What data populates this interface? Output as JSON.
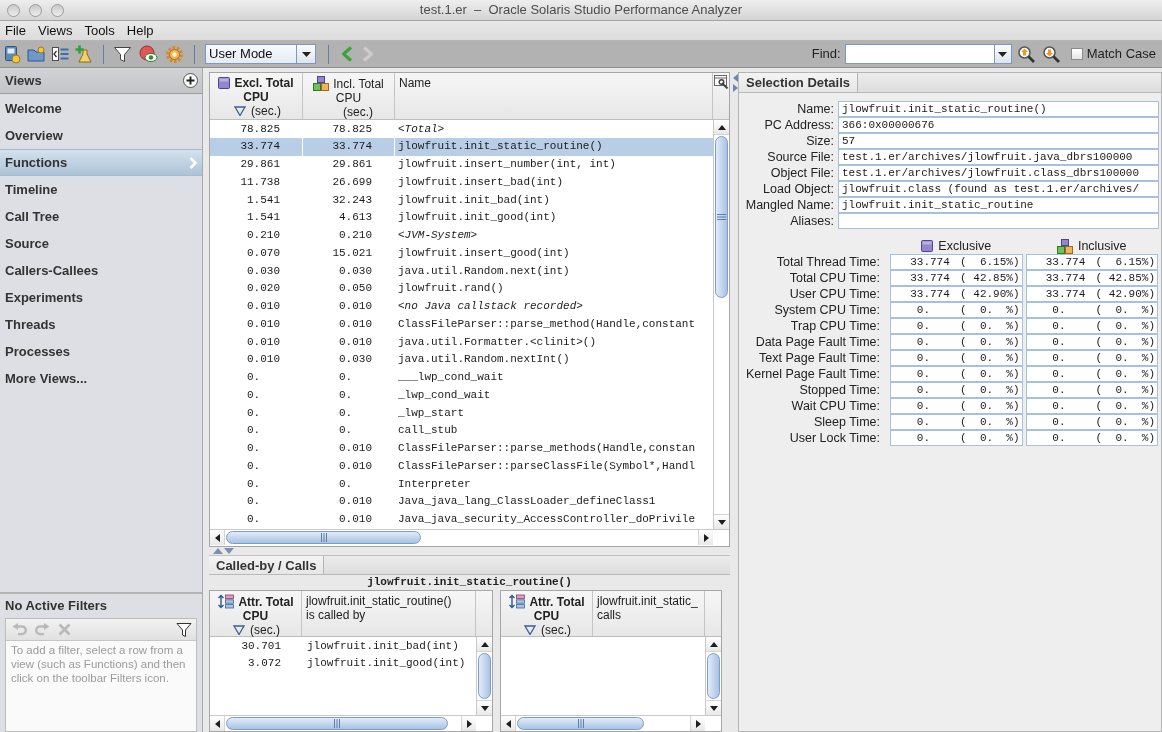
{
  "window": {
    "title": "test.1.er  –  Oracle Solaris Studio Performance Analyzer"
  },
  "menu": [
    "File",
    "Views",
    "Tools",
    "Help"
  ],
  "toolbar": {
    "view_mode": "User Mode",
    "navigation": [
      {
        "kind": "back",
        "disabled": false
      },
      {
        "kind": "forward",
        "disabled": true
      }
    ],
    "find": {
      "label": "Find:",
      "match_case": {
        "label": "Match Case",
        "checked": false
      }
    }
  },
  "sidebar": {
    "title": "Views",
    "items": [
      {
        "label": "Welcome",
        "selected": false
      },
      {
        "label": "Overview",
        "selected": false
      },
      {
        "label": "Functions",
        "selected": true
      },
      {
        "label": "Timeline",
        "selected": false
      },
      {
        "label": "Call Tree",
        "selected": false
      },
      {
        "label": "Source",
        "selected": false
      },
      {
        "label": "Callers-Callees",
        "selected": false
      },
      {
        "label": "Experiments",
        "selected": false
      },
      {
        "label": "Threads",
        "selected": false
      },
      {
        "label": "Processes",
        "selected": false
      },
      {
        "label": "More Views...",
        "selected": false
      }
    ],
    "filters": {
      "title": "No Active Filters",
      "actions": [
        {
          "kind": "undo",
          "disabled": true
        },
        {
          "kind": "redo",
          "disabled": true
        },
        {
          "kind": "clear",
          "disabled": true
        }
      ],
      "hint": "To add a filter, select a row from a view (such as Functions) and then click on the toolbar Filters icon."
    }
  },
  "functions_table": {
    "columns": [
      {
        "kind": "exclusive",
        "lines": [
          "Excl. Total",
          "CPU"
        ],
        "unit": "(sec.)",
        "sorted": true
      },
      {
        "kind": "inclusive",
        "lines": [
          "Incl. Total",
          "CPU"
        ],
        "unit": "(sec.)",
        "sorted": false
      },
      {
        "kind": "name",
        "lines": [
          "Name"
        ],
        "sorted": false
      }
    ],
    "rows": [
      {
        "exclusive_cpu": "78.825",
        "inclusive_cpu": "78.825",
        "name": "<Total>",
        "kind": "pseudo",
        "selected": false
      },
      {
        "exclusive_cpu": "33.774",
        "inclusive_cpu": "33.774",
        "name": "jlowfruit.init_static_routine()",
        "kind": "function",
        "selected": true
      },
      {
        "exclusive_cpu": "29.861",
        "inclusive_cpu": "29.861",
        "name": "jlowfruit.insert_number(int, int)",
        "kind": "function",
        "selected": false
      },
      {
        "exclusive_cpu": "11.738",
        "inclusive_cpu": "26.699",
        "name": "jlowfruit.insert_bad(int)",
        "kind": "function",
        "selected": false
      },
      {
        "exclusive_cpu": "1.541",
        "inclusive_cpu": "32.243",
        "name": "jlowfruit.init_bad(int)",
        "kind": "function",
        "selected": false
      },
      {
        "exclusive_cpu": "1.541",
        "inclusive_cpu": "4.613",
        "name": "jlowfruit.init_good(int)",
        "kind": "function",
        "selected": false
      },
      {
        "exclusive_cpu": "0.210",
        "inclusive_cpu": "0.210",
        "name": "<JVM-System>",
        "kind": "pseudo",
        "selected": false
      },
      {
        "exclusive_cpu": "0.070",
        "inclusive_cpu": "15.021",
        "name": "jlowfruit.insert_good(int)",
        "kind": "function",
        "selected": false
      },
      {
        "exclusive_cpu": "0.030",
        "inclusive_cpu": "0.030",
        "name": "java.util.Random.next(int)",
        "kind": "function",
        "selected": false
      },
      {
        "exclusive_cpu": "0.020",
        "inclusive_cpu": "0.050",
        "name": "jlowfruit.rand()",
        "kind": "function",
        "selected": false
      },
      {
        "exclusive_cpu": "0.010",
        "inclusive_cpu": "0.010",
        "name": "<no Java callstack recorded>",
        "kind": "pseudo",
        "selected": false
      },
      {
        "exclusive_cpu": "0.010",
        "inclusive_cpu": "0.010",
        "name": "ClassFileParser::parse_method(Handle,constant",
        "kind": "function",
        "selected": false
      },
      {
        "exclusive_cpu": "0.010",
        "inclusive_cpu": "0.010",
        "name": "java.util.Formatter.<clinit>()",
        "kind": "function",
        "selected": false
      },
      {
        "exclusive_cpu": "0.010",
        "inclusive_cpu": "0.030",
        "name": "java.util.Random.nextInt()",
        "kind": "function",
        "selected": false
      },
      {
        "exclusive_cpu": "0.",
        "inclusive_cpu": "0.",
        "name": "___lwp_cond_wait",
        "kind": "function",
        "selected": false
      },
      {
        "exclusive_cpu": "0.",
        "inclusive_cpu": "0.",
        "name": "_lwp_cond_wait",
        "kind": "function",
        "selected": false
      },
      {
        "exclusive_cpu": "0.",
        "inclusive_cpu": "0.",
        "name": "_lwp_start",
        "kind": "function",
        "selected": false
      },
      {
        "exclusive_cpu": "0.",
        "inclusive_cpu": "0.",
        "name": "call_stub",
        "kind": "function",
        "selected": false
      },
      {
        "exclusive_cpu": "0.",
        "inclusive_cpu": "0.010",
        "name": "ClassFileParser::parse_methods(Handle,constan",
        "kind": "function",
        "selected": false
      },
      {
        "exclusive_cpu": "0.",
        "inclusive_cpu": "0.010",
        "name": "ClassFileParser::parseClassFile(Symbol*,Handl",
        "kind": "function",
        "selected": false
      },
      {
        "exclusive_cpu": "0.",
        "inclusive_cpu": "0.",
        "name": "Interpreter",
        "kind": "function",
        "selected": false
      },
      {
        "exclusive_cpu": "0.",
        "inclusive_cpu": "0.010",
        "name": "Java_java_lang_ClassLoader_defineClass1",
        "kind": "function",
        "selected": false
      },
      {
        "exclusive_cpu": "0.",
        "inclusive_cpu": "0.010",
        "name": "Java_java_security_AccessController_doPrivile",
        "kind": "function",
        "selected": false
      }
    ]
  },
  "called_by_calls": {
    "tabs": [
      {
        "label": "Called-by / Calls",
        "selected": true
      }
    ],
    "title": "jlowfruit.init_static_routine()",
    "callers": {
      "columns": [
        {
          "kind": "attributed",
          "lines": [
            "Attr. Total",
            "CPU"
          ],
          "unit": "(sec.)",
          "sorted": true
        },
        {
          "kind": "name",
          "lines": [
            "jlowfruit.init_static_routine()",
            "is called by"
          ],
          "sorted": false
        }
      ],
      "rows": [
        {
          "attributed_cpu": "30.701",
          "name": "jlowfruit.init_bad(int)"
        },
        {
          "attributed_cpu": "3.072",
          "name": "jlowfruit.init_good(int)"
        }
      ]
    },
    "callees": {
      "columns": [
        {
          "kind": "attributed",
          "lines": [
            "Attr. Total",
            "CPU"
          ],
          "unit": "(sec.)",
          "sorted": true
        },
        {
          "kind": "name",
          "lines": [
            "jlowfruit.init_static_",
            "calls"
          ],
          "sorted": false
        }
      ]
    }
  },
  "selection_details": {
    "tabs": [
      {
        "label": "Selection Details",
        "selected": true
      }
    ],
    "fields": [
      {
        "label": "Name:",
        "value": "jlowfruit.init_static_routine()"
      },
      {
        "label": "PC Address:",
        "value": "366:0x00000676"
      },
      {
        "label": "Size:",
        "value": "57"
      },
      {
        "label": "Source File:",
        "value": "test.1.er/archives/jlowfruit.java_dbrs100000"
      },
      {
        "label": "Object File:",
        "value": "test.1.er/archives/jlowfruit.class_dbrs100000"
      },
      {
        "label": "Load Object:",
        "value": "jlowfruit.class (found as test.1.er/archives/"
      },
      {
        "label": "Mangled Name:",
        "value": "jlowfruit.init_static_routine"
      },
      {
        "label": "Aliases:"
      }
    ],
    "metric_columns": [
      {
        "kind": "exclusive",
        "label": "Exclusive"
      },
      {
        "kind": "inclusive",
        "label": "Inclusive"
      }
    ],
    "metrics": [
      {
        "label": "Total Thread Time:",
        "exclusive": {
          "value": "33.774",
          "share": "(  6.15%)"
        },
        "inclusive": {
          "value": "33.774",
          "share": "(  6.15%)"
        }
      },
      {
        "label": "Total CPU Time:",
        "exclusive": {
          "value": "33.774",
          "share": "( 42.85%)"
        },
        "inclusive": {
          "value": "33.774",
          "share": "( 42.85%)"
        }
      },
      {
        "label": "User CPU Time:",
        "exclusive": {
          "value": "33.774",
          "share": "( 42.90%)"
        },
        "inclusive": {
          "value": "33.774",
          "share": "( 42.90%)"
        }
      },
      {
        "label": "System CPU Time:",
        "exclusive": {
          "value": "0.",
          "share": "(  0.  %)"
        },
        "inclusive": {
          "value": "0.",
          "share": "(  0.  %)"
        }
      },
      {
        "label": "Trap CPU Time:",
        "exclusive": {
          "value": "0.",
          "share": "(  0.  %)"
        },
        "inclusive": {
          "value": "0.",
          "share": "(  0.  %)"
        }
      },
      {
        "label": "Data Page Fault Time:",
        "exclusive": {
          "value": "0.",
          "share": "(  0.  %)"
        },
        "inclusive": {
          "value": "0.",
          "share": "(  0.  %)"
        }
      },
      {
        "label": "Text Page Fault Time:",
        "exclusive": {
          "value": "0.",
          "share": "(  0.  %)"
        },
        "inclusive": {
          "value": "0.",
          "share": "(  0.  %)"
        }
      },
      {
        "label": "Kernel Page Fault Time:",
        "exclusive": {
          "value": "0.",
          "share": "(  0.  %)"
        },
        "inclusive": {
          "value": "0.",
          "share": "(  0.  %)"
        }
      },
      {
        "label": "Stopped Time:",
        "exclusive": {
          "value": "0.",
          "share": "(  0.  %)"
        },
        "inclusive": {
          "value": "0.",
          "share": "(  0.  %)"
        }
      },
      {
        "label": "Wait CPU Time:",
        "exclusive": {
          "value": "0.",
          "share": "(  0.  %)"
        },
        "inclusive": {
          "value": "0.",
          "share": "(  0.  %)"
        }
      },
      {
        "label": "Sleep Time:",
        "exclusive": {
          "value": "0.",
          "share": "(  0.  %)"
        },
        "inclusive": {
          "value": "0.",
          "share": "(  0.  %)"
        }
      },
      {
        "label": "User Lock Time:",
        "exclusive": {
          "value": "0.",
          "share": "(  0.  %)"
        },
        "inclusive": {
          "value": "0.",
          "share": "(  0.  %)"
        }
      }
    ]
  }
}
